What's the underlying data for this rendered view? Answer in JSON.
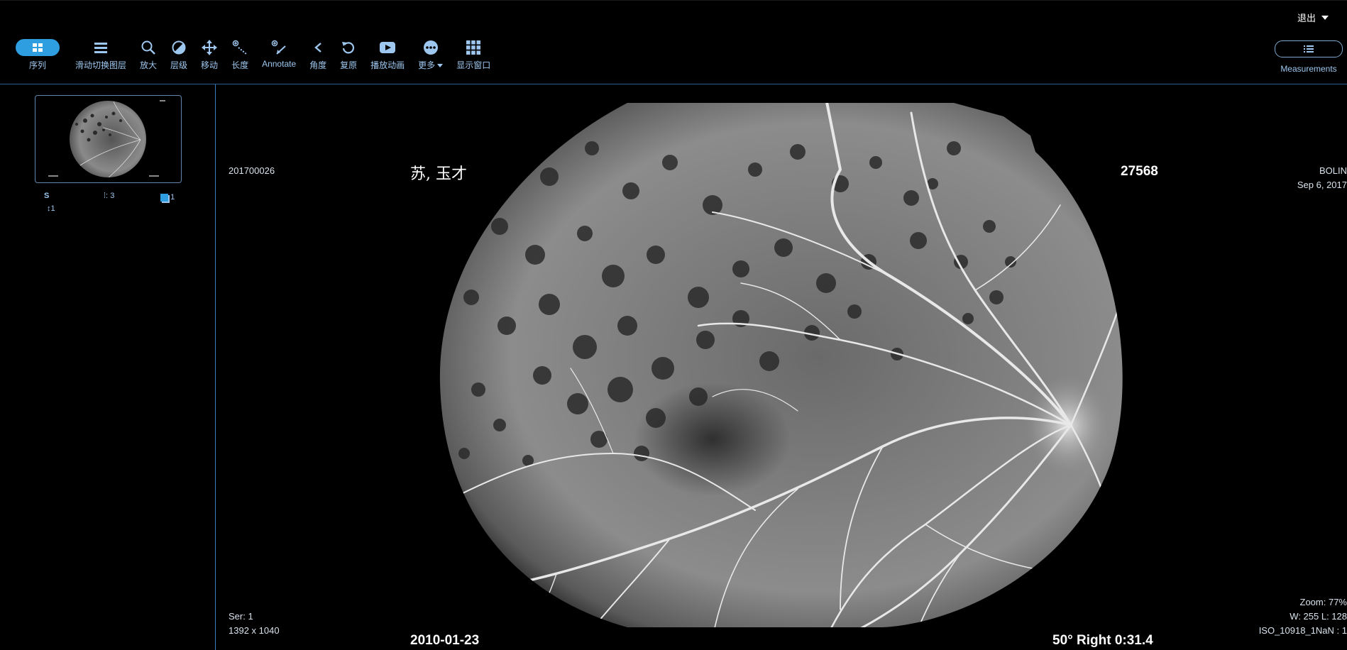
{
  "header": {
    "logout_label": "退出",
    "tools": [
      {
        "id": "series",
        "label": "序列",
        "icon": "grid-icon"
      },
      {
        "id": "stack",
        "label": "滑动切换图层",
        "icon": "menu-lines-icon"
      },
      {
        "id": "zoom",
        "label": "放大",
        "icon": "search-icon"
      },
      {
        "id": "level",
        "label": "层级",
        "icon": "contrast-icon"
      },
      {
        "id": "move",
        "label": "移动",
        "icon": "move-icon"
      },
      {
        "id": "length",
        "label": "长度",
        "icon": "ruler-icon"
      },
      {
        "id": "annotate",
        "label": "Annotate",
        "icon": "annotate-icon"
      },
      {
        "id": "angle",
        "label": "角度",
        "icon": "angle-icon"
      },
      {
        "id": "reset",
        "label": "复原",
        "icon": "reset-icon"
      },
      {
        "id": "cine",
        "label": "播放动画",
        "icon": "play-icon"
      },
      {
        "id": "more",
        "label": "更多",
        "icon": "more-icon"
      },
      {
        "id": "layout",
        "label": "显示窗口",
        "icon": "layout-grid-icon"
      }
    ],
    "measurements_label": "Measurements"
  },
  "thumbnail": {
    "series_label": "S",
    "series_number": "1",
    "image_count": "3",
    "instance_count": "1"
  },
  "overlay": {
    "patient_id": "201700026",
    "patient_name": "苏, 玉才",
    "study_number": "27568",
    "institution": "BOLIN",
    "study_date": "Sep 6, 2017",
    "series": "Ser: 1",
    "dimensions": "1392 x 1040",
    "acq_date": "2010-01-23",
    "acq_info": "50° Right 0:31.4",
    "zoom": "Zoom: 77%",
    "window_level": "W: 255 L: 128",
    "iso": "ISO_10918_1NaN : 1"
  },
  "colors": {
    "accent": "#2f9ee0",
    "toolbar_text": "#9ec7ef",
    "divider": "#3a7fc0"
  }
}
